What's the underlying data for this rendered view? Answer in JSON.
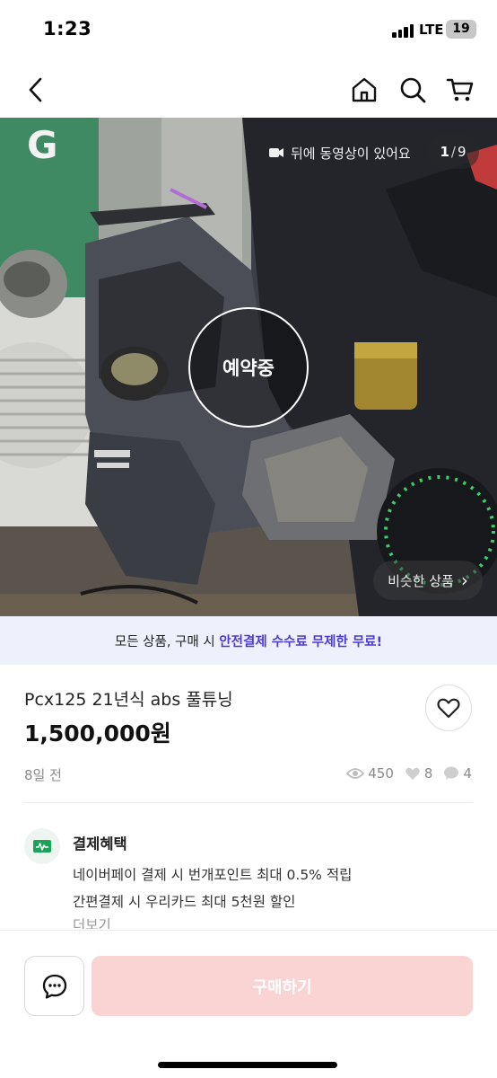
{
  "status_bar": {
    "time": "1:23",
    "network": "LTE",
    "battery": "19"
  },
  "nav": {
    "back_icon": "chevron-left-icon",
    "home_icon": "home-icon",
    "search_icon": "search-icon",
    "cart_icon": "cart-icon"
  },
  "hero": {
    "video_note": "뒤에 동영상이 있어요",
    "page_current": "1",
    "page_total": "9",
    "page_separator": "/",
    "status_badge": "예약중",
    "similar_label": "비슷한 상품",
    "similar_chevron": "›"
  },
  "banner": {
    "prefix": "모든 상품, 구매 시 ",
    "highlight": "안전결제 수수료 무제한 무료!"
  },
  "product": {
    "title": "Pcx125 21년식 abs 풀튜닝",
    "price": "1,500,000원",
    "posted": "8일 전",
    "views": "450",
    "likes": "8",
    "chats": "4"
  },
  "benefits": {
    "title": "결제혜택",
    "lines": [
      "네이버페이 결제 시 번개포인트 최대 0.5% 적립",
      "간편결제 시 우리카드 최대 5천원 할인"
    ],
    "more": "더보기"
  },
  "bottom": {
    "buy_label": "구매하기"
  },
  "colors": {
    "accent": "#4a3ad6",
    "buy_button": "#fad3d3",
    "banner_bg": "#eef0fb"
  }
}
